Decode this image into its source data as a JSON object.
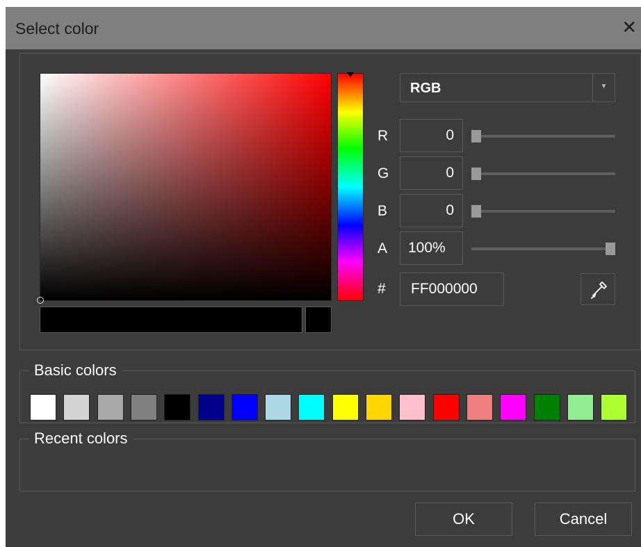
{
  "dialog": {
    "title": "Select color"
  },
  "mode": {
    "selected": "RGB"
  },
  "channels": {
    "r": {
      "label": "R",
      "value": "0",
      "level": 0
    },
    "g": {
      "label": "G",
      "value": "0",
      "level": 0
    },
    "b": {
      "label": "B",
      "value": "0",
      "level": 0
    },
    "a": {
      "label": "A",
      "value": "100%",
      "level": 1
    }
  },
  "hex": {
    "label": "#",
    "value": "FF000000"
  },
  "basic_colors": {
    "title": "Basic colors",
    "swatches": [
      "#ffffff",
      "#d3d3d3",
      "#a9a9a9",
      "#808080",
      "#000000",
      "#00008b",
      "#0000ff",
      "#add8e6",
      "#00ffff",
      "#ffff00",
      "#ffd700",
      "#ffc0cb",
      "#ff0000",
      "#f08080",
      "#ff00ff",
      "#008000",
      "#90ee90",
      "#adff2f"
    ]
  },
  "recent_colors": {
    "title": "Recent colors"
  },
  "buttons": {
    "ok": "OK",
    "cancel": "Cancel"
  },
  "icons": {
    "close": "close-icon",
    "dropdown": "chevron-down-icon",
    "eyedropper": "eyedropper-icon"
  }
}
